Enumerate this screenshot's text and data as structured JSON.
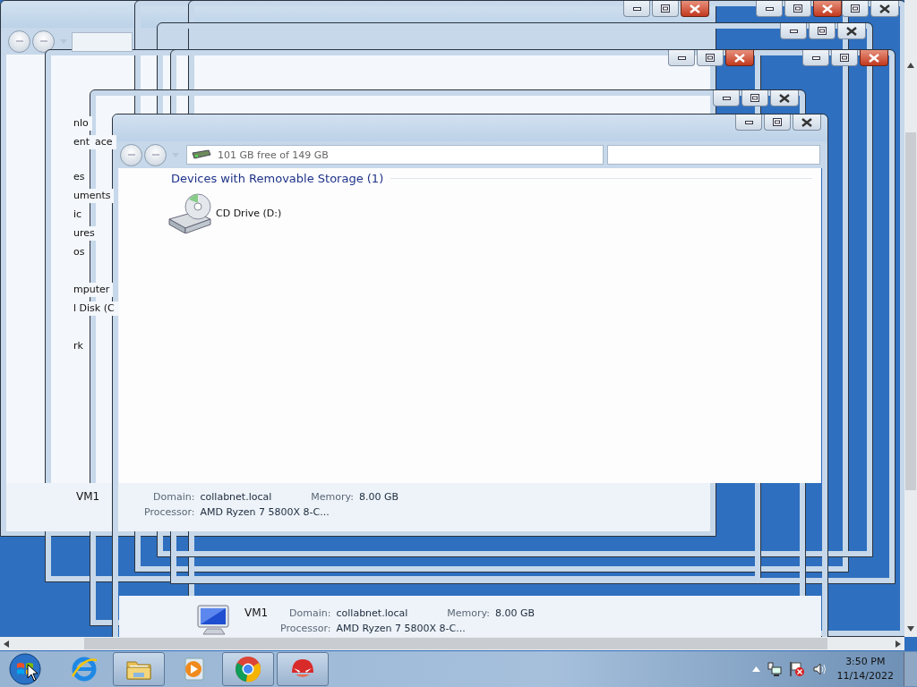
{
  "frames": [
    {
      "active": true
    },
    {
      "active": true
    },
    {
      "active": false
    },
    {
      "active": false
    },
    {
      "active": true
    },
    {
      "active": true
    },
    {
      "active": false
    }
  ],
  "back_window": {
    "sidebar": [
      "nlo",
      "ent",
      "ace",
      "es",
      "uments",
      "ic",
      "ures",
      "os",
      "mputer",
      "l Disk (C",
      "rk"
    ],
    "details": {
      "name": "VM1",
      "domain_label": "Domain:",
      "domain": "collabnet.local",
      "memory_label": "Memory:",
      "memory": "8.00 GB",
      "processor_label": "Processor:",
      "processor": "AMD Ryzen 7 5800X 8-C..."
    }
  },
  "front_window": {
    "active": false,
    "free_space": "101 GB free of 149 GB",
    "group": "Devices with Removable Storage (1)",
    "items": [
      {
        "name": "CD Drive (D:)"
      }
    ],
    "details": {
      "name": "VM1",
      "domain_label": "Domain:",
      "domain": "collabnet.local",
      "memory_label": "Memory:",
      "memory": "8.00 GB",
      "processor_label": "Processor:",
      "processor": "AMD Ryzen 7 5800X 8-C..."
    }
  },
  "taskbar": {
    "items": [
      {
        "kind": "ie",
        "running": false
      },
      {
        "kind": "explorer",
        "running": true
      },
      {
        "kind": "media",
        "running": false
      },
      {
        "kind": "chrome",
        "running": true
      },
      {
        "kind": "mask",
        "running": true
      }
    ],
    "time": "3:50 PM",
    "date": "11/14/2022"
  }
}
